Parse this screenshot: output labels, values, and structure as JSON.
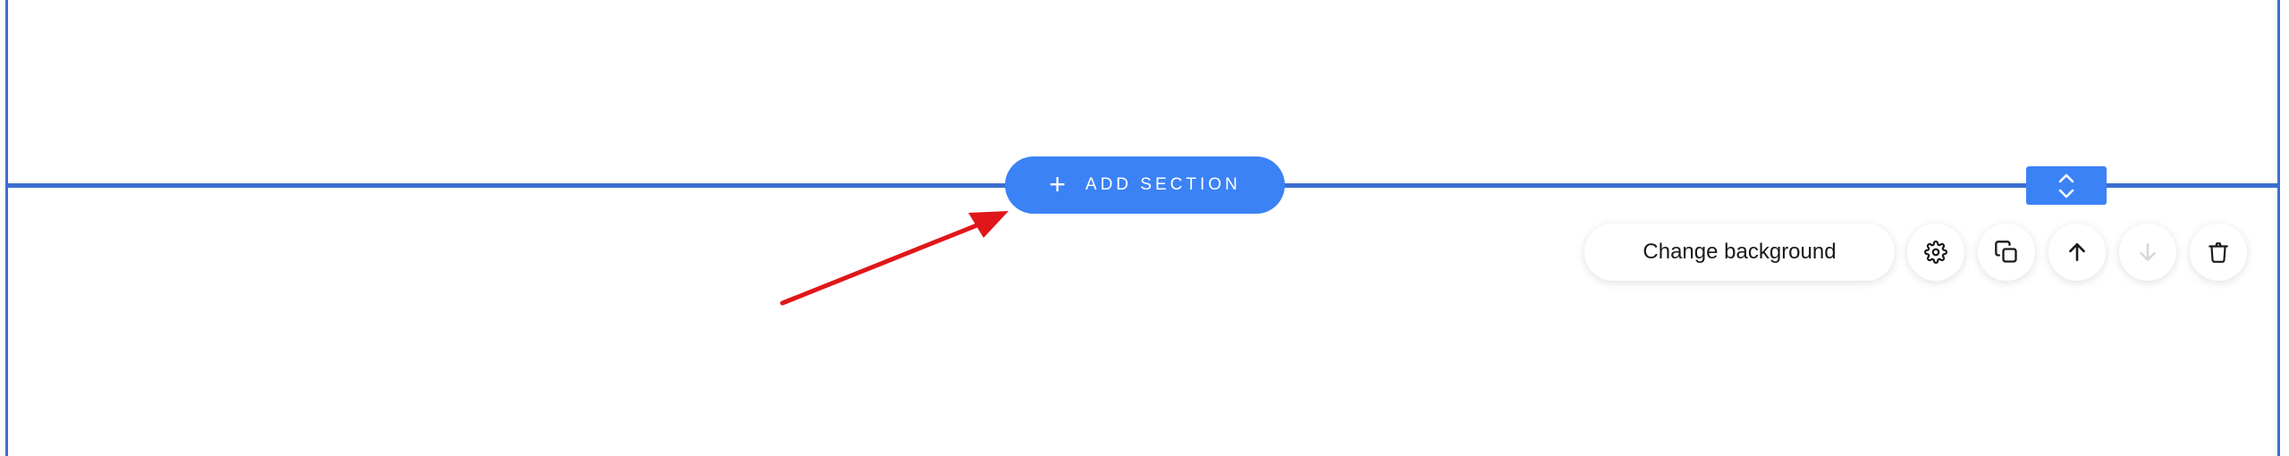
{
  "add_section": {
    "plus": "+",
    "label": "ADD SECTION"
  },
  "toolbar": {
    "change_background_label": "Change background",
    "buttons": [
      {
        "icon": "gear-icon",
        "enabled": true
      },
      {
        "icon": "duplicate-icon",
        "enabled": true
      },
      {
        "icon": "arrow-up-icon",
        "enabled": true
      },
      {
        "icon": "arrow-down-icon",
        "enabled": false
      },
      {
        "icon": "trash-icon",
        "enabled": true
      }
    ]
  },
  "colors": {
    "accent": "#3b82f6",
    "frame": "#3b6fcf",
    "annotation_arrow": "#e0161a"
  }
}
